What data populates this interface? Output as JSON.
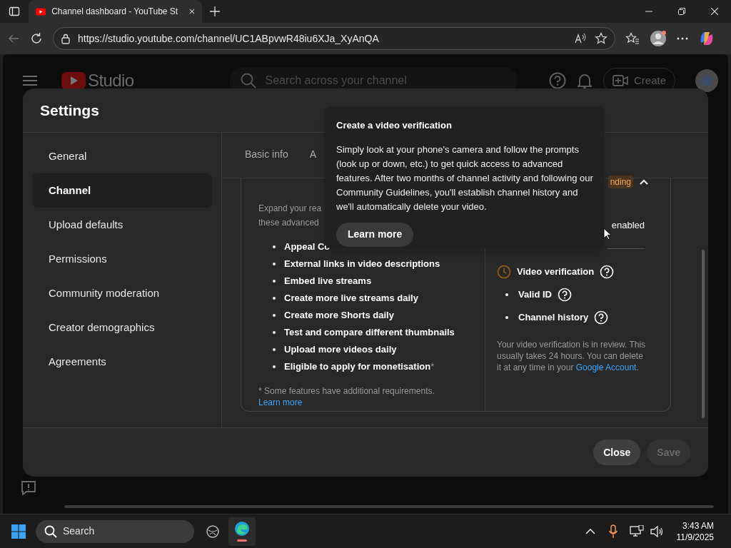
{
  "browser": {
    "tab_title": "Channel dashboard - YouTube St",
    "url": "https://studio.youtube.com/channel/UC1ABpvwR48iu6XJa_XyAnQA"
  },
  "studio_header": {
    "logo_text": "Studio",
    "search_placeholder": "Search across your channel",
    "create_button": "Create"
  },
  "settings": {
    "title": "Settings",
    "nav": [
      {
        "label": "General",
        "selected": false
      },
      {
        "label": "Channel",
        "selected": true
      },
      {
        "label": "Upload defaults",
        "selected": false
      },
      {
        "label": "Permissions",
        "selected": false
      },
      {
        "label": "Community moderation",
        "selected": false
      },
      {
        "label": "Creator demographics",
        "selected": false
      },
      {
        "label": "Agreements",
        "selected": false
      }
    ],
    "tabs": [
      {
        "label": "Basic info",
        "selected": false
      },
      {
        "label": "A",
        "selected": false
      }
    ],
    "features": {
      "intro_lines": [
        "Expand your rea",
        "these advanced"
      ],
      "items": [
        {
          "text": "Appeal Co"
        },
        {
          "text": "External links in video descriptions"
        },
        {
          "text": "Embed live streams"
        },
        {
          "text": "Create more live streams daily"
        },
        {
          "text": "Create more Shorts daily"
        },
        {
          "text": "Test and compare different thumbnails"
        },
        {
          "text": "Upload more videos daily"
        },
        {
          "text": "Eligible to apply for monetisation",
          "mark": "*"
        }
      ],
      "footnote": "* Some features have additional requirements. ",
      "footnote_link": "Learn more"
    },
    "status": {
      "badge": "nding",
      "expanded": true,
      "enabled_label": "enabled",
      "requirements": [
        {
          "label": "Video verification",
          "kind": "pending"
        },
        {
          "label": "Valid ID",
          "kind": "bullet"
        },
        {
          "label": "Channel history",
          "kind": "bullet"
        }
      ],
      "review_text": "Your video verification is in review. This usually takes 24 hours. You can delete it at any time in your ",
      "review_link": "Google Account",
      "review_end": "."
    },
    "buttons": [
      {
        "label": "Close",
        "disabled": false
      },
      {
        "label": "Save",
        "disabled": true
      }
    ]
  },
  "tooltip": {
    "title": "Create a video verification",
    "body": "Simply look at your phone's camera and follow the prompts (look up or down, etc.) to get quick access to advanced features. After two months of channel activity and following our Community Guidelines, you'll establish channel history and we'll automatically delete your video.",
    "button": "Learn more"
  },
  "taskbar": {
    "search_placeholder": "Search",
    "time": "3:43 AM",
    "date": "11/9/2025"
  }
}
